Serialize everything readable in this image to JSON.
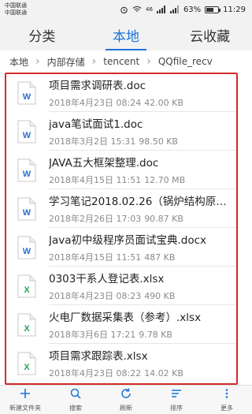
{
  "status": {
    "carrier1": "中国联通",
    "carrier2": "中国联通",
    "signal": "46",
    "battery": "63%",
    "battery_level": 0.63,
    "time": "11:29"
  },
  "tabs": [
    {
      "label": "分类",
      "active": false
    },
    {
      "label": "本地",
      "active": true
    },
    {
      "label": "云收藏",
      "active": false
    }
  ],
  "breadcrumb": [
    "本地",
    "内部存储",
    "tencent",
    "QQfile_recv"
  ],
  "files": [
    {
      "name": "项目需求调研表.doc",
      "date": "2018年4月23日 08:24",
      "size": "42.00 KB",
      "type": "doc"
    },
    {
      "name": "java笔试面试1.doc",
      "date": "2018年3月2日 15:31",
      "size": "98.50 KB",
      "type": "doc"
    },
    {
      "name": "JAVA五大框架整理.doc",
      "date": "2018年4月15日 11:51",
      "size": "12.70 MB",
      "type": "doc"
    },
    {
      "name": "学习笔记2018.02.26（锅炉结构原理及…",
      "date": "2018年2月26日 17:03",
      "size": "90.87 KB",
      "type": "doc"
    },
    {
      "name": "Java初中级程序员面试宝典.docx",
      "date": "2018年4月15日 11:51",
      "size": "487 KB",
      "type": "doc"
    },
    {
      "name": "0303干系人登记表.xlsx",
      "date": "2018年4月23日 08:23",
      "size": "490 KB",
      "type": "xls"
    },
    {
      "name": "火电厂数据采集表（参考）.xlsx",
      "date": "2018年3月6日 17:21",
      "size": "9.78 KB",
      "type": "xls"
    },
    {
      "name": "项目需求跟踪表.xlsx",
      "date": "2018年4月23日 08:22",
      "size": "14.02 KB",
      "type": "xls"
    }
  ],
  "toolbar": [
    {
      "label": "新建文件夹",
      "icon": "plus-icon"
    },
    {
      "label": "搜索",
      "icon": "search-icon"
    },
    {
      "label": "刷新",
      "icon": "refresh-icon"
    },
    {
      "label": "排序",
      "icon": "sort-icon"
    },
    {
      "label": "更多",
      "icon": "more-icon"
    }
  ],
  "colors": {
    "accent": "#1a73d9",
    "highlight_border": "#d42a2a",
    "doc_icon": "#2b6fd1",
    "xls_icon": "#27a35a"
  }
}
